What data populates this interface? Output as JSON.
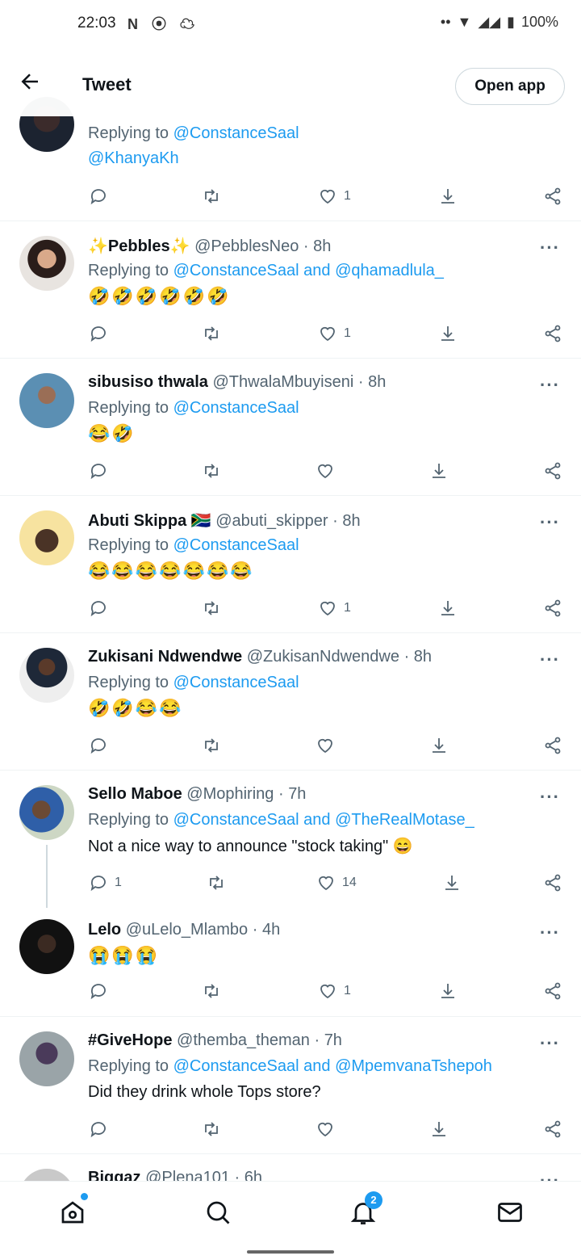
{
  "status_bar": {
    "time": "22:03",
    "battery": "100%"
  },
  "header": {
    "title": "Tweet",
    "open_app_label": "Open app"
  },
  "tweets": [
    {
      "name": "",
      "handle": "",
      "time": "",
      "replying_label": "Replying to",
      "reply_to": "@ConstanceSaal",
      "reply_to_second": "",
      "extra_mention": "@KhanyaKh",
      "text": "",
      "likes": "1",
      "replies": ""
    },
    {
      "name": "✨Pebbles✨",
      "handle": "@PebblesNeo",
      "time": "8h",
      "replying_label": "Replying to",
      "reply_to": "@ConstanceSaal",
      "conjunction": "and",
      "reply_to_second": "@qhamadlula_",
      "text": "🤣🤣🤣🤣🤣🤣",
      "likes": "1",
      "replies": ""
    },
    {
      "name": "sibusiso thwala",
      "handle": "@ThwalaMbuyiseni",
      "time": "8h",
      "replying_label": "Replying to",
      "reply_to": "@ConstanceSaal",
      "text": "😂🤣",
      "likes": "",
      "replies": ""
    },
    {
      "name": "Abuti Skippa 🇿🇦",
      "handle": "@abuti_skipper",
      "time": "8h",
      "replying_label": "Replying to",
      "reply_to": "@ConstanceSaal",
      "text": "😂😂😂😂😂😂😂",
      "likes": "1",
      "replies": ""
    },
    {
      "name": "Zukisani Ndwendwe",
      "handle": "@ZukisanNdwendwe",
      "time": "8h",
      "replying_label": "Replying to",
      "reply_to": "@ConstanceSaal",
      "text": "🤣🤣😂😂",
      "likes": "",
      "replies": ""
    },
    {
      "name": "Sello Maboe",
      "handle": "@Mophiring",
      "time": "7h",
      "replying_label": "Replying to",
      "reply_to": "@ConstanceSaal",
      "conjunction": "and",
      "reply_to_second": "@TheRealMotase_",
      "text": "Not a nice way to announce \"stock taking\" 😄",
      "likes": "14",
      "replies": "1"
    },
    {
      "name": "Lelo",
      "handle": "@uLelo_Mlambo",
      "time": "4h",
      "text": "😭😭😭",
      "likes": "1",
      "replies": ""
    },
    {
      "name": "#GiveHope",
      "handle": "@themba_theman",
      "time": "7h",
      "replying_label": "Replying to",
      "reply_to": "@ConstanceSaal",
      "conjunction": "and",
      "reply_to_second": "@MpemvanaTshepoh",
      "text": "Did they drink whole Tops store?",
      "likes": "",
      "replies": ""
    },
    {
      "name": "Biggaz",
      "handle": "@Plena101",
      "time": "6h"
    }
  ],
  "separator": "·",
  "more_glyph": "···",
  "bottom_nav": {
    "notifications_badge": "2"
  },
  "icons": [
    "back-arrow-icon",
    "reply-icon",
    "retweet-icon",
    "heart-icon",
    "download-icon",
    "share-icon",
    "home-icon",
    "search-icon",
    "bell-icon",
    "mail-icon"
  ],
  "colors": {
    "accent": "#1d9bf0",
    "secondary_text": "#536471"
  }
}
